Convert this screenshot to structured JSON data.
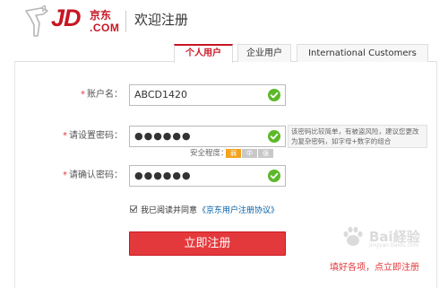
{
  "header": {
    "logo_jd": "JD",
    "logo_cn": "京东",
    "logo_com": ".COM",
    "title": "欢迎注册"
  },
  "tabs": [
    {
      "label": "个人用户",
      "active": true
    },
    {
      "label": "企业用户",
      "active": false
    },
    {
      "label": "International Customers",
      "active": false
    }
  ],
  "form": {
    "required_mark": "*",
    "username": {
      "label": "账户名：",
      "value": "ABCD1420",
      "valid": true
    },
    "password": {
      "label": "请设置密码：",
      "value": "●●●●●●",
      "valid": true
    },
    "password_hint": "该密码比较简单，有被盗风险，建议您更改为复杂密码，如字母+数字的组合",
    "strength": {
      "label": "安全程度：",
      "levels": [
        "弱",
        "中",
        "强"
      ],
      "current": "弱"
    },
    "confirm": {
      "label": "请确认密码：",
      "value": "●●●●●●",
      "valid": true
    },
    "agreement": {
      "text": "我已阅读并同意",
      "link": "《京东用户注册协议》",
      "checked": true
    },
    "submit_label": "立即注册"
  },
  "annotation": "填好各项，点立即注册",
  "watermark": {
    "text": "Bai経验",
    "sub": "jingyan.baidu.com"
  },
  "colors": {
    "brand_red": "#c81623",
    "button_red": "#e4393c",
    "valid_green": "#5cb82b",
    "weak_orange": "#f3a31c",
    "link_blue": "#005ea7"
  }
}
